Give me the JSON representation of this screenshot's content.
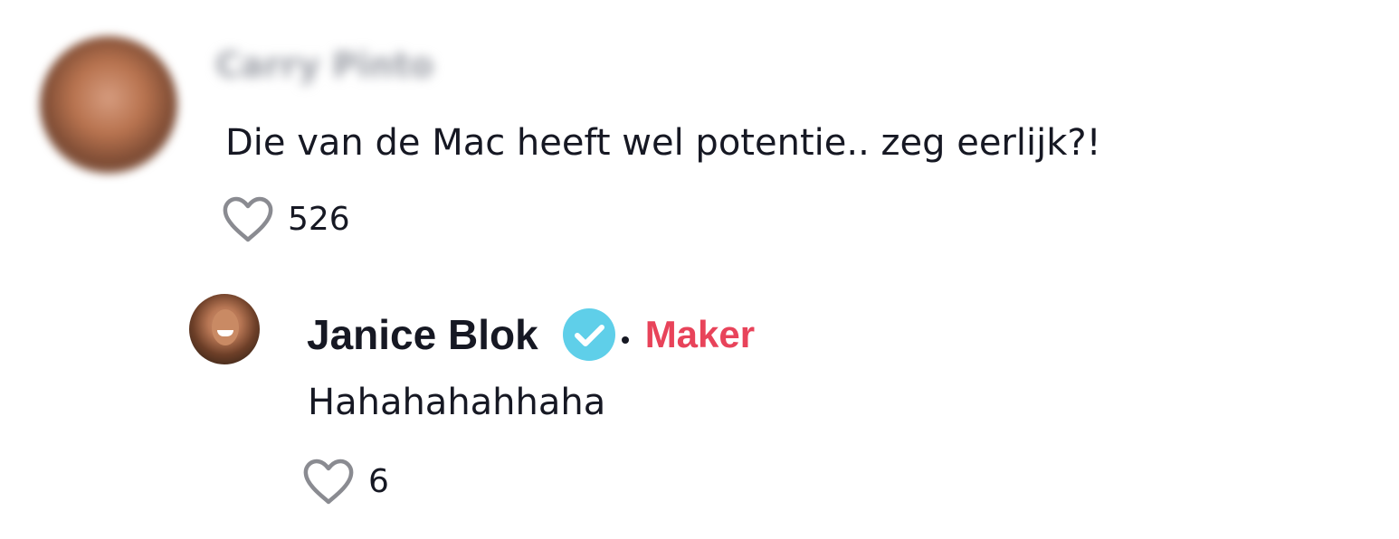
{
  "comment": {
    "username": "Carry Pinto",
    "text": "Die van de Mac heeft wel potentie.. zeg eerlijk?!",
    "likes": "526"
  },
  "reply": {
    "username": "Janice Blok",
    "badge": "Maker",
    "text": "Hahahahahhaha",
    "likes": "6"
  },
  "colors": {
    "maker": "#e8435a",
    "verified": "#5fcfe9",
    "text": "#161823",
    "heart": "#8a8b91"
  },
  "icons": {
    "like": "heart-outline-icon",
    "verified": "verified-check-icon"
  }
}
